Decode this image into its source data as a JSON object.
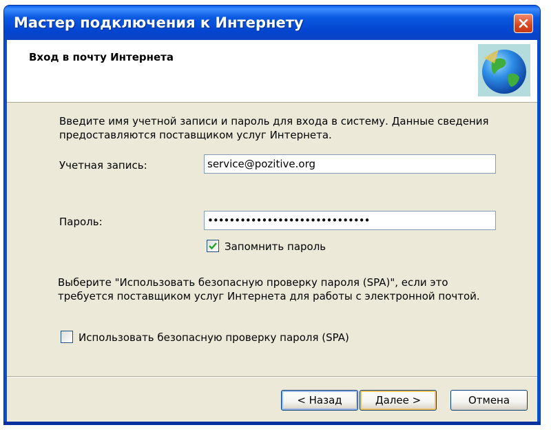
{
  "window": {
    "title": "Мастер подключения к Интернету",
    "close_icon": "close-icon"
  },
  "header": {
    "title": "Вход в почту Интернета",
    "icon": "globe-icon"
  },
  "intro": {
    "line1": "Введите имя учетной записи и пароль для входа в систему. Данные сведения",
    "line2": "предоставляются поставщиком услуг Интернета."
  },
  "account": {
    "label": "Учетная запись:",
    "value": "service@pozitive.org"
  },
  "password": {
    "label": "Пароль:",
    "masked_value": "••••••••••••••••••••••••••••••"
  },
  "remember": {
    "label": "Запомнить пароль",
    "checked": true
  },
  "spa_info": {
    "line1": "Выберите \"Использовать безопасную проверку пароля (SPA)\", если это",
    "line2": "требуется поставщиком услуг Интернета для работы с электронной почтой."
  },
  "spa": {
    "label": "Использовать безопасную проверку пароля (SPA)",
    "checked": false
  },
  "buttons": {
    "back": "< Назад",
    "next": "Далее >",
    "cancel": "Отмена"
  }
}
